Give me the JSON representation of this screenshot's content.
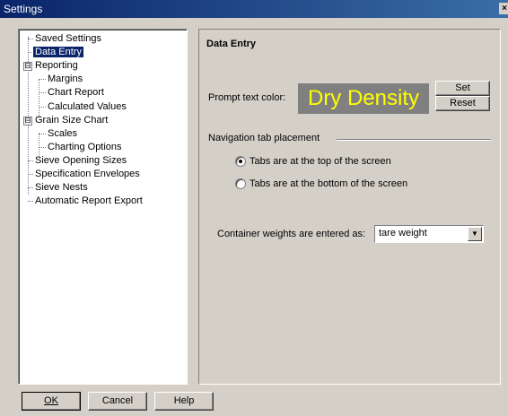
{
  "window": {
    "title": "Settings",
    "close_glyph": "×"
  },
  "tree": {
    "items": [
      {
        "label": "Saved Settings"
      },
      {
        "label": "Data Entry",
        "selected": true
      },
      {
        "label": "Reporting",
        "expander": "⊟"
      },
      {
        "label": "Margins"
      },
      {
        "label": "Chart Report"
      },
      {
        "label": "Calculated Values"
      },
      {
        "label": "Grain Size Chart",
        "expander": "⊟"
      },
      {
        "label": "Scales"
      },
      {
        "label": "Charting Options"
      },
      {
        "label": "Sieve Opening Sizes"
      },
      {
        "label": "Specification Envelopes"
      },
      {
        "label": "Sieve Nests"
      },
      {
        "label": "Automatic Report Export"
      }
    ]
  },
  "panel": {
    "title": "Data Entry",
    "prompt_text_color_label": "Prompt text color:",
    "preview_text": "Dry Density",
    "preview_bg": "#808080",
    "preview_fg": "#ffff00",
    "set_label": "Set",
    "reset_label": "Reset",
    "nav_group_label": "Navigation tab placement",
    "radio_top": "Tabs are at the top of the screen",
    "radio_bottom": "Tabs are at the bottom of the screen",
    "radio_selected": "top",
    "container_label": "Container weights are entered as:",
    "container_value": "tare weight"
  },
  "footer": {
    "ok": "OK",
    "cancel": "Cancel",
    "help": "Help"
  }
}
